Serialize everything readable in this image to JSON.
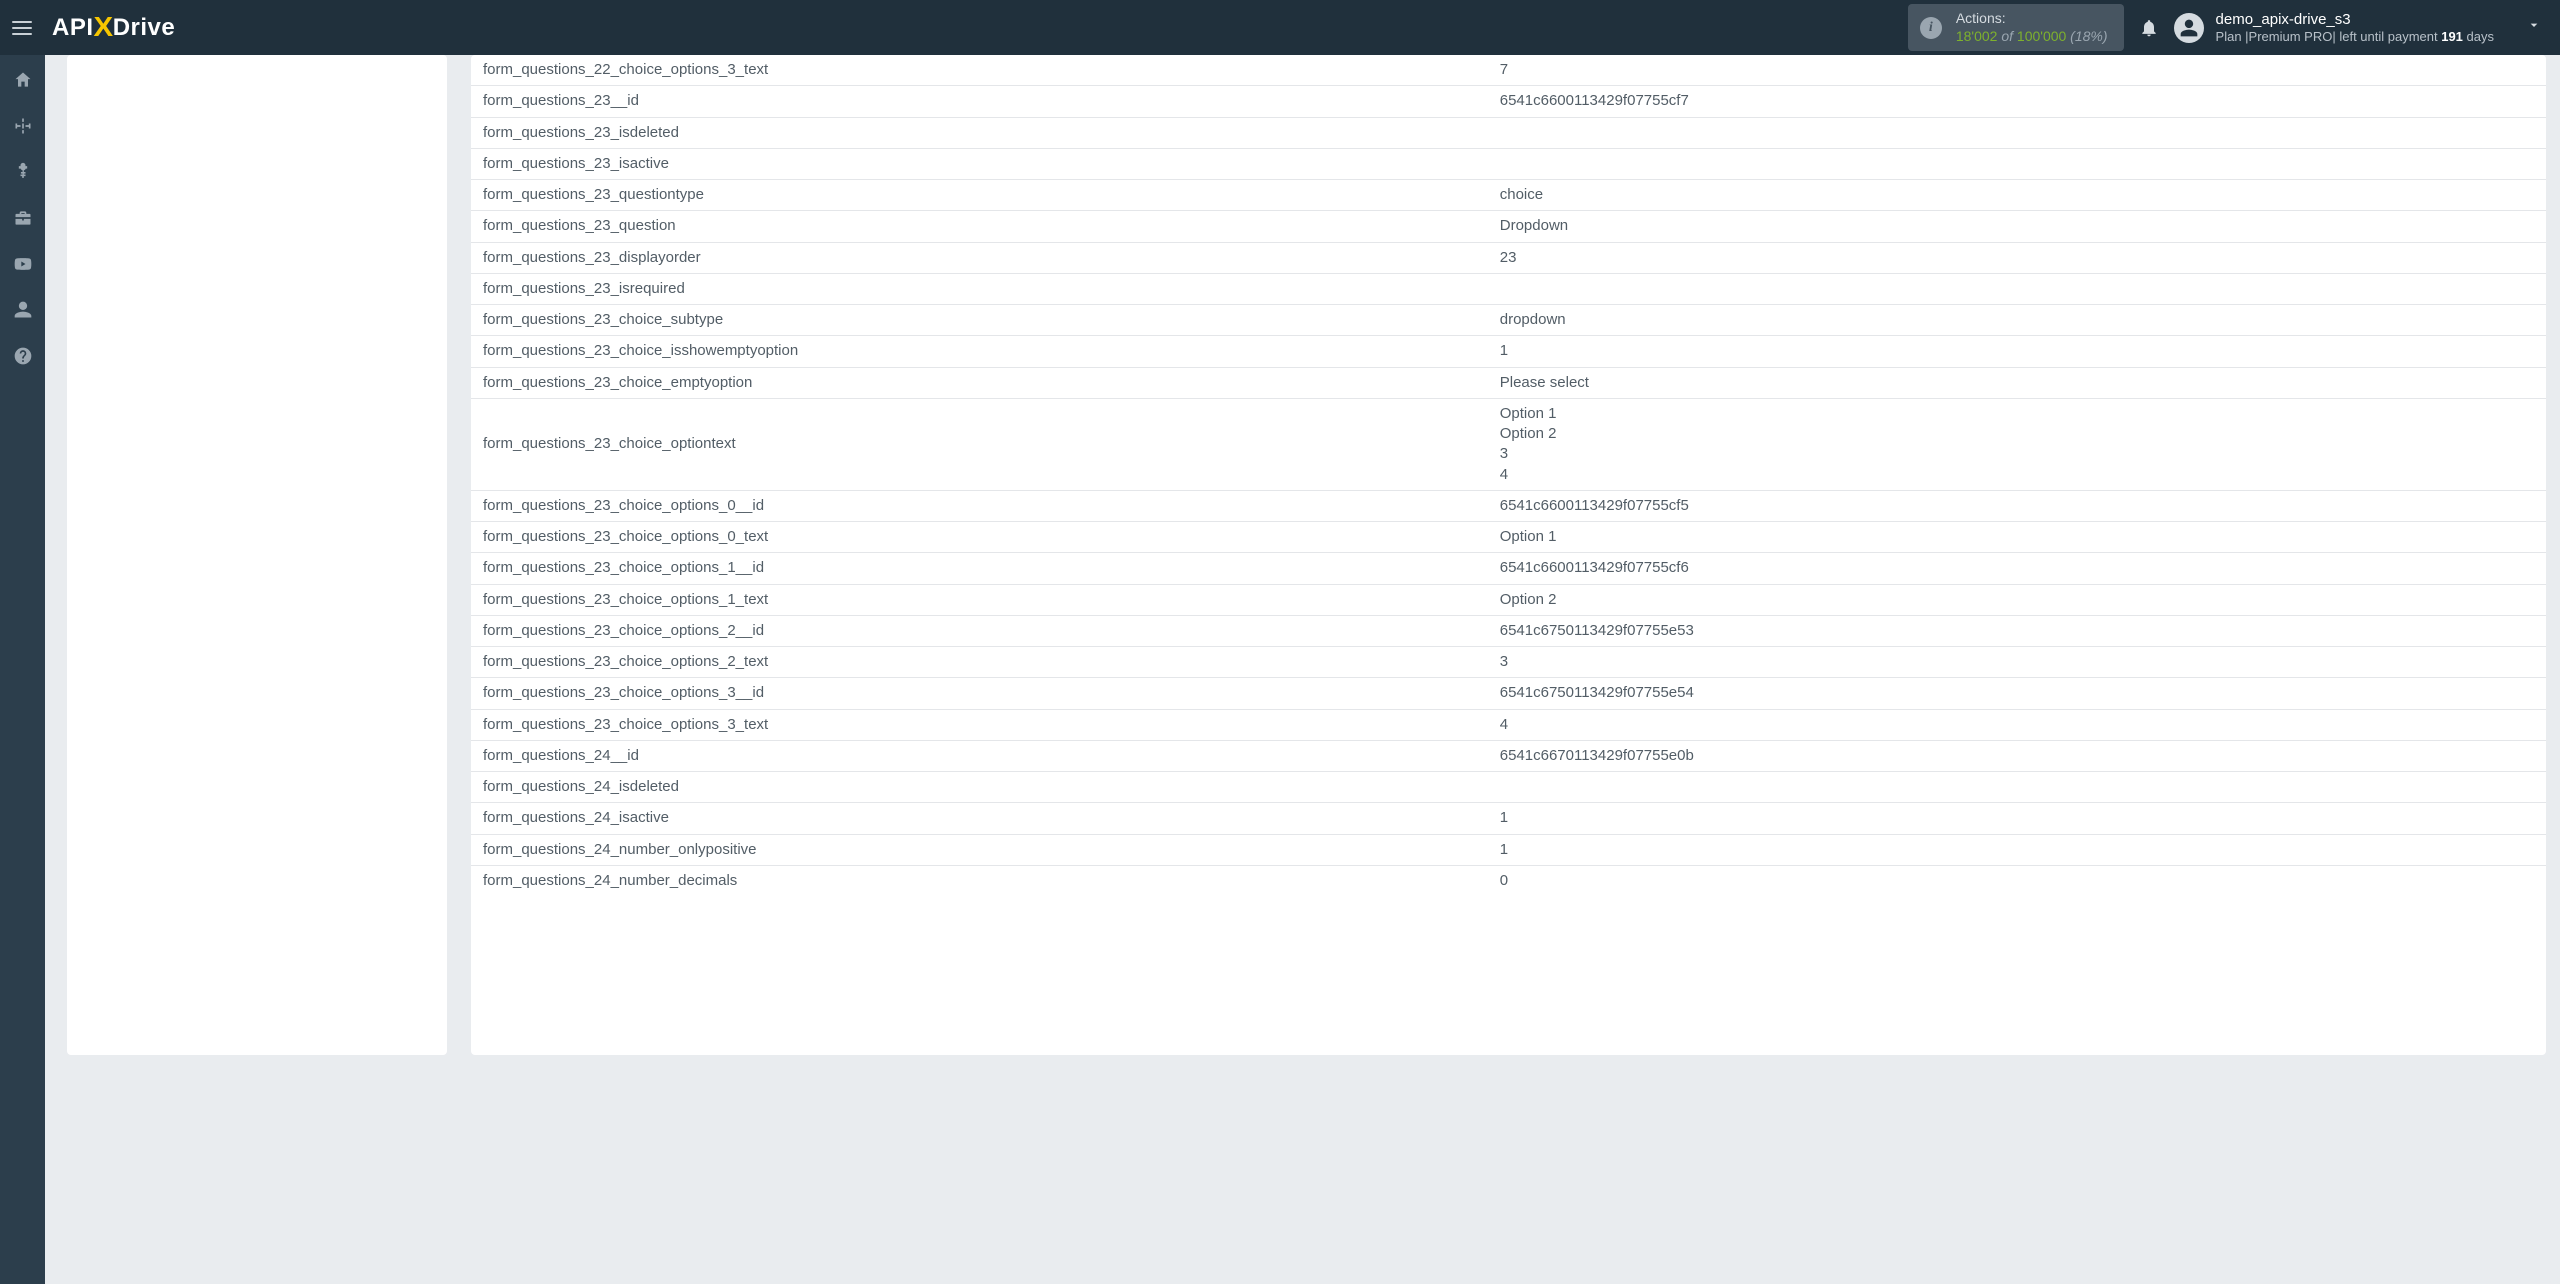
{
  "brand": {
    "prefix": "API",
    "x": "X",
    "suffix": "Drive"
  },
  "header": {
    "actions_label": "Actions:",
    "actions_used": "18'002",
    "actions_of": " of ",
    "actions_total": "100'000",
    "actions_pct": " (18%)",
    "user_name": "demo_apix-drive_s3",
    "plan_prefix": "Plan |",
    "plan_name": "Premium PRO",
    "plan_mid": "| left until payment ",
    "plan_days": "191",
    "plan_suffix": " days"
  },
  "rows": [
    {
      "k": "form_questions_22_choice_options_3_text",
      "v": "7"
    },
    {
      "k": "form_questions_23__id",
      "v": "6541c6600113429f07755cf7"
    },
    {
      "k": "form_questions_23_isdeleted",
      "v": ""
    },
    {
      "k": "form_questions_23_isactive",
      "v": ""
    },
    {
      "k": "form_questions_23_questiontype",
      "v": "choice"
    },
    {
      "k": "form_questions_23_question",
      "v": "Dropdown"
    },
    {
      "k": "form_questions_23_displayorder",
      "v": "23"
    },
    {
      "k": "form_questions_23_isrequired",
      "v": ""
    },
    {
      "k": "form_questions_23_choice_subtype",
      "v": "dropdown"
    },
    {
      "k": "form_questions_23_choice_isshowemptyoption",
      "v": "1"
    },
    {
      "k": "form_questions_23_choice_emptyoption",
      "v": "Please select"
    },
    {
      "k": "form_questions_23_choice_optiontext",
      "v": "Option 1\nOption 2\n3\n4"
    },
    {
      "k": "form_questions_23_choice_options_0__id",
      "v": "6541c6600113429f07755cf5"
    },
    {
      "k": "form_questions_23_choice_options_0_text",
      "v": "Option 1"
    },
    {
      "k": "form_questions_23_choice_options_1__id",
      "v": "6541c6600113429f07755cf6"
    },
    {
      "k": "form_questions_23_choice_options_1_text",
      "v": "Option 2"
    },
    {
      "k": "form_questions_23_choice_options_2__id",
      "v": "6541c6750113429f07755e53"
    },
    {
      "k": "form_questions_23_choice_options_2_text",
      "v": "3"
    },
    {
      "k": "form_questions_23_choice_options_3__id",
      "v": "6541c6750113429f07755e54"
    },
    {
      "k": "form_questions_23_choice_options_3_text",
      "v": "4"
    },
    {
      "k": "form_questions_24__id",
      "v": "6541c6670113429f07755e0b"
    },
    {
      "k": "form_questions_24_isdeleted",
      "v": ""
    },
    {
      "k": "form_questions_24_isactive",
      "v": "1"
    },
    {
      "k": "form_questions_24_number_onlypositive",
      "v": "1"
    },
    {
      "k": "form_questions_24_number_decimals",
      "v": "0"
    }
  ]
}
